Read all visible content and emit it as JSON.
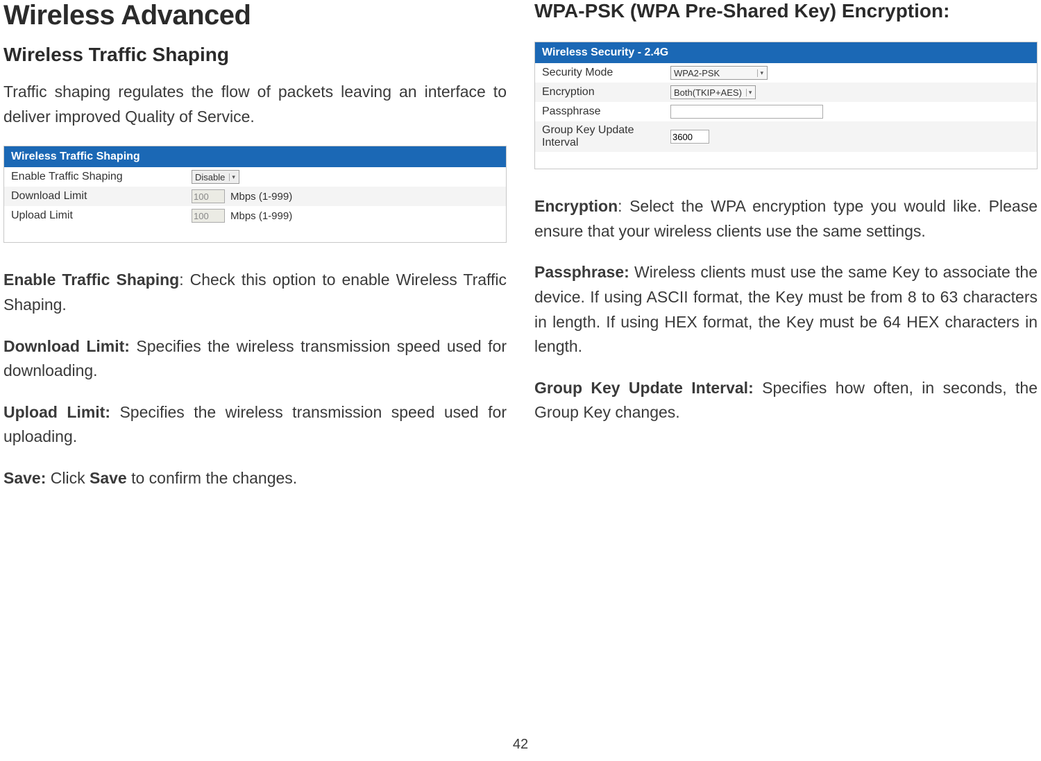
{
  "left": {
    "h1": "Wireless Advanced",
    "h2": "Wireless Traffic Shaping",
    "intro": "Traffic shaping regulates the flow of packets leaving an interface to deliver improved Quality of Service.",
    "panel": {
      "header": "Wireless Traffic Shaping",
      "rows": {
        "enable_label": "Enable Traffic Shaping",
        "enable_value": "Disable",
        "download_label": "Download Limit",
        "download_value": "100",
        "download_hint": "Mbps (1-999)",
        "upload_label": "Upload Limit",
        "upload_value": "100",
        "upload_hint": "Mbps (1-999)"
      }
    },
    "p_enable_b": "Enable Traffic Shaping",
    "p_enable_rest": ": Check this option to enable Wireless Traffic Shaping.",
    "p_download_b": "Download Limit:",
    "p_download_rest": " Specifies the wireless transmission speed used for downloading.",
    "p_upload_b": "Upload Limit:",
    "p_upload_rest": " Specifies the wireless transmission speed used for uploading.",
    "p_save_b": "Save:",
    "p_save_mid": " Click ",
    "p_save_b2": "Save",
    "p_save_rest": " to confirm the changes."
  },
  "right": {
    "h3": "WPA-PSK (WPA Pre-Shared Key) Encryption:",
    "panel": {
      "header": "Wireless Security - 2.4G",
      "rows": {
        "mode_label": "Security Mode",
        "mode_value": "WPA2-PSK",
        "enc_label": "Encryption",
        "enc_value": "Both(TKIP+AES)",
        "pass_label": "Passphrase",
        "pass_value": "",
        "interval_label": "Group Key Update Interval",
        "interval_value": "3600"
      }
    },
    "p_enc_b": "Encryption",
    "p_enc_rest": ": Select the WPA encryption type you would like. Please ensure that your wireless clients use the same settings.",
    "p_pass_b": "Passphrase:",
    "p_pass_rest": " Wireless clients must use the same Key to associate the device. If using ASCII format, the Key must be from 8 to 63 characters in length. If using HEX format, the Key must be 64 HEX characters in length.",
    "p_group_b": "Group Key Update Interval:",
    "p_group_rest": " Specifies how often, in seconds, the Group Key changes."
  },
  "page_number": "42"
}
